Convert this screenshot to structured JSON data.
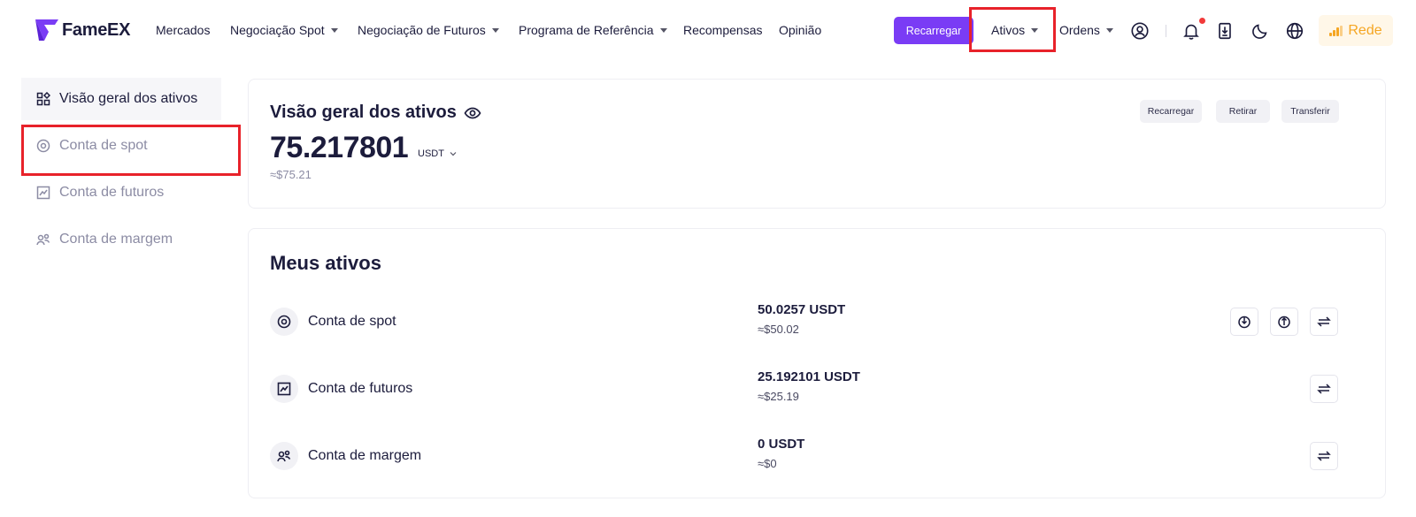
{
  "header": {
    "brand": "FameEX",
    "nav": [
      {
        "label": "Mercados"
      },
      {
        "label": "Negociação Spot"
      },
      {
        "label": "Negociação de Futuros"
      },
      {
        "label": "Programa de Referência"
      },
      {
        "label": "Recompensas"
      },
      {
        "label": "Opinião"
      }
    ],
    "recharge_label": "Recarregar",
    "ativos_label": "Ativos",
    "ordens_label": "Ordens",
    "rede_label": "Rede",
    "icons": [
      "user-icon",
      "bell-icon",
      "download-icon",
      "moon-icon",
      "globe-icon"
    ],
    "accent": "#7a3cf5",
    "highlight": "#e8222a"
  },
  "sidebar": {
    "items": [
      {
        "label": "Visão geral dos ativos",
        "icon": "overview-grid-icon"
      },
      {
        "label": "Conta de spot",
        "icon": "spot-account-icon"
      },
      {
        "label": "Conta de futuros",
        "icon": "futures-account-icon"
      },
      {
        "label": "Conta de margem",
        "icon": "margin-account-icon"
      }
    ]
  },
  "overview": {
    "title": "Visão geral dos ativos",
    "amount": "75.217801",
    "unit": "USDT",
    "approx": "≈$75.21",
    "actions": [
      "Recarregar",
      "Retirar",
      "Transferir"
    ]
  },
  "assets": {
    "title": "Meus ativos",
    "rows": [
      {
        "name": "Conta de spot",
        "amount": "50.0257 USDT",
        "fiat": "≈$50.02",
        "actions": [
          "deposit-icon",
          "withdraw-icon",
          "transfer-icon"
        ]
      },
      {
        "name": "Conta de futuros",
        "amount": "25.192101 USDT",
        "fiat": "≈$25.19",
        "actions": [
          "transfer-icon"
        ]
      },
      {
        "name": "Conta de margem",
        "amount": "0 USDT",
        "fiat": "≈$0",
        "actions": [
          "transfer-icon"
        ]
      }
    ]
  }
}
